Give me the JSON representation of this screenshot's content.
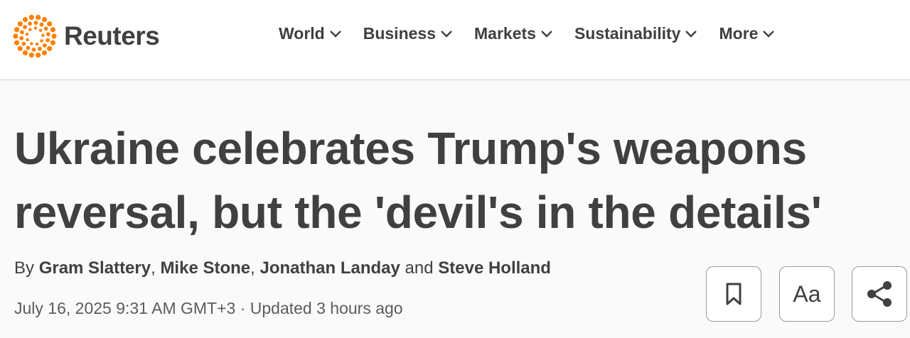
{
  "brand": {
    "name": "Reuters",
    "accent": "#ff8000"
  },
  "nav": [
    {
      "label": "World"
    },
    {
      "label": "Business"
    },
    {
      "label": "Markets"
    },
    {
      "label": "Sustainability"
    },
    {
      "label": "More"
    }
  ],
  "article": {
    "headline_line1": "Ukraine celebrates Trump's weapons",
    "headline_line2": "reversal, but the 'devil's in the details'",
    "by_prefix": "By",
    "authors": [
      "Gram Slattery",
      "Mike Stone",
      "Jonathan Landay",
      "Steve Holland"
    ],
    "sep_comma": ",",
    "sep_and": "and",
    "date": "July 16, 2025 9:31 AM GMT+3",
    "dot": "·",
    "updated": "Updated 3 hours ago"
  },
  "actions": {
    "bookmark_icon": "bookmark-icon",
    "text_size_label": "Aa",
    "share_icon": "share-icon"
  }
}
